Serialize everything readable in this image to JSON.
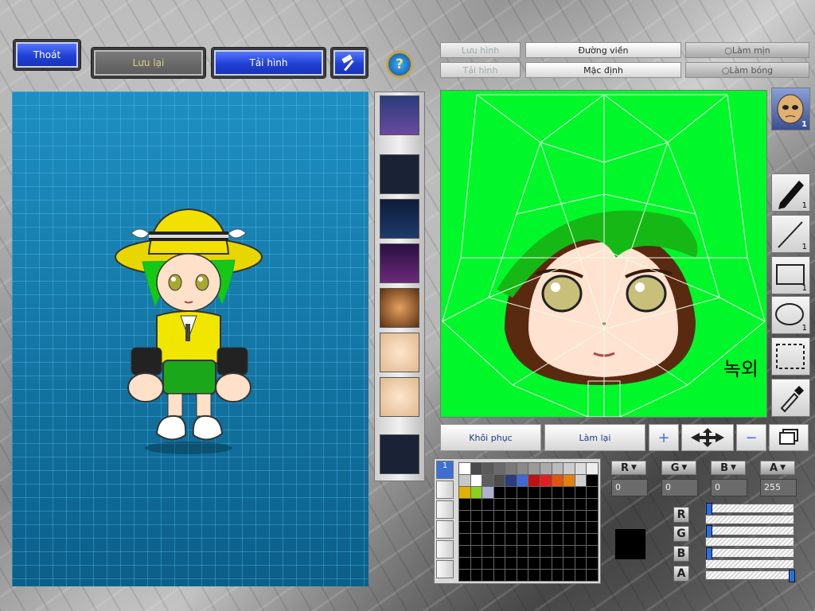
{
  "top_buttons": {
    "exit": "Thoát",
    "save": "Lưu lại",
    "load": "Tải hình"
  },
  "help_label": "?",
  "editor_toolbar": {
    "save_image": "Lưu hình",
    "outline": "Đường viền",
    "smooth": "Làm mịn",
    "load_image": "Tải hình",
    "default": "Mặc định",
    "shade": "Làm bóng"
  },
  "face_caption": "녹외",
  "profile_badge_count": "1",
  "tools": [
    {
      "name": "pen",
      "count": "1"
    },
    {
      "name": "line",
      "count": "1"
    },
    {
      "name": "rectangle",
      "count": "1"
    },
    {
      "name": "ellipse",
      "count": "1"
    },
    {
      "name": "selection",
      "count": ""
    },
    {
      "name": "eyedropper",
      "count": ""
    }
  ],
  "bottom_buttons": {
    "restore": "Khôi phục",
    "redo": "Làm lại"
  },
  "palette": {
    "row1": [
      "#ffffff",
      "#4a4a4a",
      "#5a5a5a",
      "#6a6a6a",
      "#7a7a7a",
      "#8a8a8a",
      "#9a9a9a",
      "#aaaaaa",
      "#bbbbbb",
      "#cccccc",
      "#dddddd",
      "#eeeeee"
    ],
    "row2": [
      "#c8c8c8",
      "#ffffff",
      "#5e5e5e",
      "#4c4c4c",
      "#2b3d7c",
      "#3d6bd1",
      "#c01010",
      "#e02020",
      "#e05510",
      "#e08010",
      "#d0d0d0",
      "#000000"
    ],
    "row3": [
      "#e0b000",
      "#8ad020",
      "#b0b0d0",
      "#000000",
      "#000000",
      "#000000",
      "#000000",
      "#000000",
      "#000000",
      "#000000",
      "#000000",
      "#000000"
    ],
    "active_tab": "1"
  },
  "channels": {
    "r_label": "R",
    "g_label": "G",
    "b_label": "B",
    "a_label": "A",
    "r_value": "0",
    "g_value": "0",
    "b_value": "0",
    "a_value": "255"
  },
  "sliders": {
    "r": 0,
    "g": 0,
    "b": 0,
    "a": 1
  },
  "current_color": "#000000"
}
